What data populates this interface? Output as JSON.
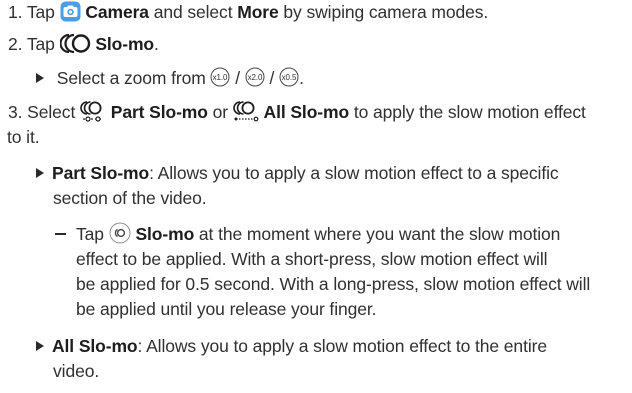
{
  "steps": [
    {
      "number": "1.",
      "tap": "Tap",
      "camera_icon": "camera-app-icon",
      "camera": "Camera",
      "and_select": "and select",
      "more": "More",
      "rest": "by swiping camera modes."
    },
    {
      "number": "2.",
      "tap": "Tap",
      "slomo_icon": "slo-mo-mode-icon",
      "slomo": "Slo-mo",
      "period": ".",
      "sub": {
        "text": "Select a zoom from",
        "zoom_options": [
          "x1.0",
          "x2.0",
          "x0.5"
        ],
        "sep": "/",
        "end": "."
      }
    },
    {
      "number": "3.",
      "select": "Select",
      "part_icon": "part-slo-mo-icon",
      "part": "Part Slo-mo",
      "or": "or",
      "all_icon": "all-slo-mo-icon",
      "all": "All Slo-mo",
      "rest_line1": "to apply the slow motion effect",
      "rest_line2": "to it.",
      "bullets": [
        {
          "term": "Part Slo-mo",
          "line1": ": Allows you to apply a slow motion effect to a specific",
          "line2": "section of the video.",
          "sub": {
            "tap": "Tap",
            "button_icon": "slo-mo-record-button-icon",
            "slomo": "Slo-mo",
            "line1": "at the moment where you want the slow motion",
            "line2": "effect to be applied. With a short-press, slow motion effect will",
            "line3": "be applied for 0.5 second. With a long-press, slow motion effect will",
            "line4": "be applied until you release your finger."
          }
        },
        {
          "term": "All Slo-mo",
          "line1": ": Allows you to apply a slow motion effect to the entire",
          "line2": "video."
        }
      ]
    }
  ]
}
